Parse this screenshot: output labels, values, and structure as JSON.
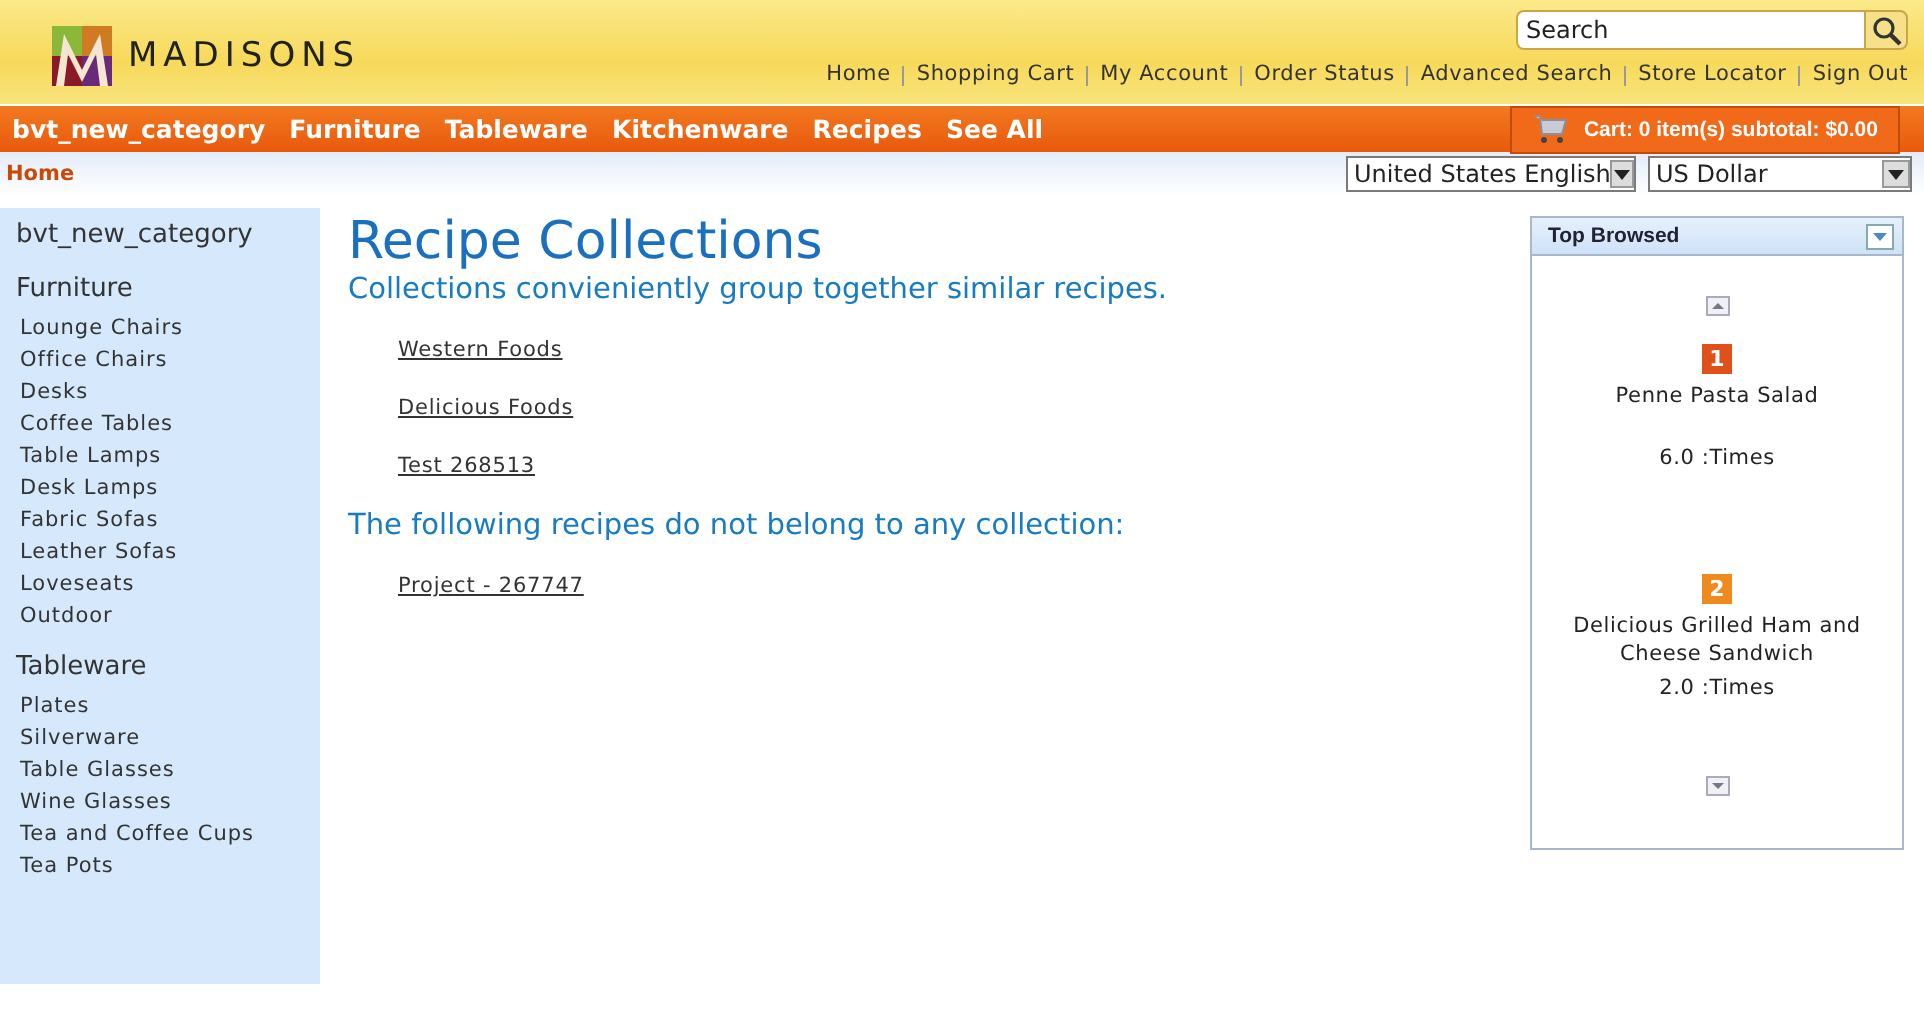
{
  "logo": {
    "text": "MADISONS"
  },
  "search": {
    "placeholder": "Search"
  },
  "header_links": [
    "Home",
    "Shopping Cart",
    "My Account",
    "Order Status",
    "Advanced Search",
    "Store Locator",
    "Sign Out"
  ],
  "nav": [
    "bvt_new_category",
    "Furniture",
    "Tableware",
    "Kitchenware",
    "Recipes",
    "See All"
  ],
  "cart": {
    "text": "Cart: 0 item(s) subtotal: $0.00"
  },
  "breadcrumb": "Home",
  "language": {
    "value": "United States English"
  },
  "currency": {
    "value": "US Dollar"
  },
  "sidebar": {
    "groups": [
      {
        "title": "bvt_new_category"
      },
      {
        "title": "Furniture",
        "items": [
          "Lounge Chairs",
          "Office Chairs",
          "Desks",
          "Coffee Tables",
          "Table Lamps",
          "Desk Lamps",
          "Fabric Sofas",
          "Leather Sofas",
          "Loveseats",
          "Outdoor"
        ]
      },
      {
        "title": "Tableware",
        "items": [
          "Plates",
          "Silverware",
          "Table Glasses",
          "Wine Glasses",
          "Tea and Coffee Cups",
          "Tea Pots"
        ]
      }
    ]
  },
  "main": {
    "title": "Recipe Collections",
    "subtitle": "Collections convieniently group together similar recipes.",
    "collections": [
      "Western Foods",
      "Delicious Foods",
      "Test 268513"
    ],
    "orphan_heading": "The following recipes do not belong to any collection:",
    "orphans": [
      "Project - 267747"
    ]
  },
  "top_browsed": {
    "title": "Top Browsed",
    "items": [
      {
        "rank": "1",
        "color": "#e0501a",
        "name": "Penne Pasta Salad",
        "count": "6.0 :Times"
      },
      {
        "rank": "2",
        "color": "#ee8a1e",
        "name": "Delicious Grilled Ham and Cheese Sandwich",
        "count": "2.0 :Times"
      }
    ]
  }
}
